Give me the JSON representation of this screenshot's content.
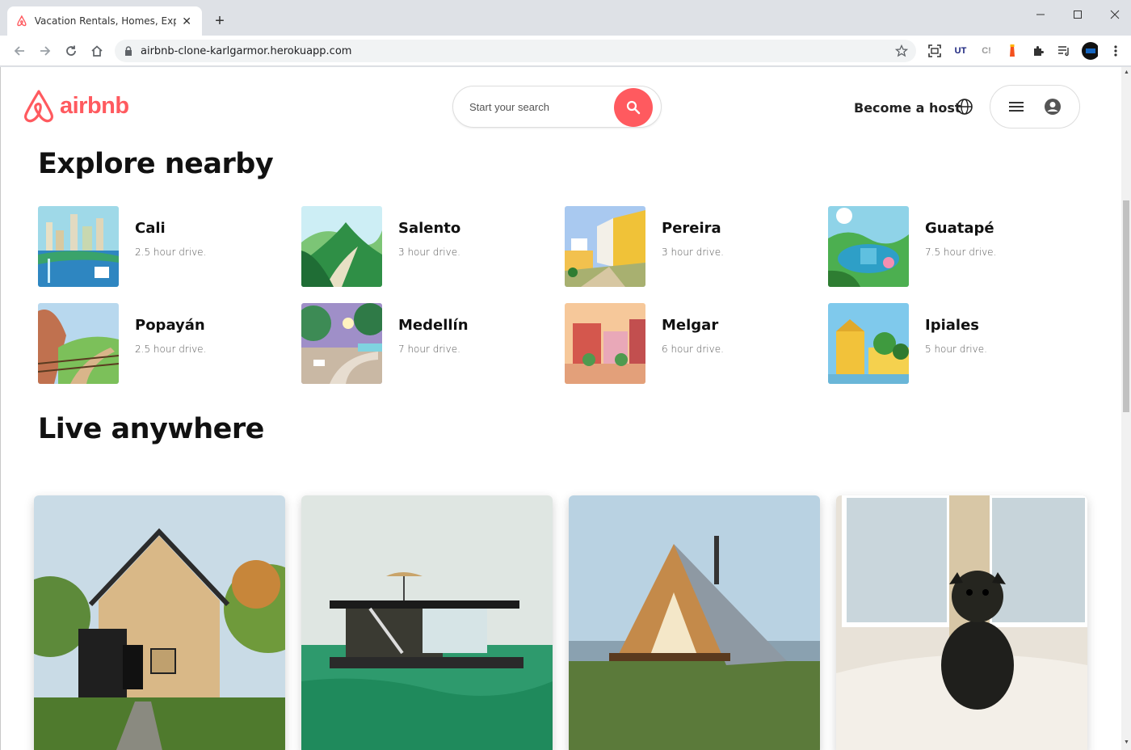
{
  "browser": {
    "tab_title": "Vacation Rentals, Homes, Experie",
    "url": "airbnb-clone-karlgarmor.herokuapp.com",
    "extensions": [
      "UT",
      "C!"
    ]
  },
  "header": {
    "logo_text": "airbnb",
    "search_placeholder": "Start your search",
    "become_host": "Become a host"
  },
  "explore": {
    "title": "Explore nearby",
    "places": [
      {
        "name": "Cali",
        "distance": "2.5 hour drive."
      },
      {
        "name": "Salento",
        "distance": "3 hour drive."
      },
      {
        "name": "Pereira",
        "distance": "3 hour drive."
      },
      {
        "name": "Guatapé",
        "distance": "7.5 hour drive."
      },
      {
        "name": "Popayán",
        "distance": "2.5 hour drive."
      },
      {
        "name": "Medellín",
        "distance": "7 hour drive."
      },
      {
        "name": "Melgar",
        "distance": "6 hour drive."
      },
      {
        "name": "Ipiales",
        "distance": "5 hour drive."
      }
    ]
  },
  "live": {
    "title": "Live anywhere"
  },
  "colors": {
    "brand": "#ff5a5f"
  }
}
